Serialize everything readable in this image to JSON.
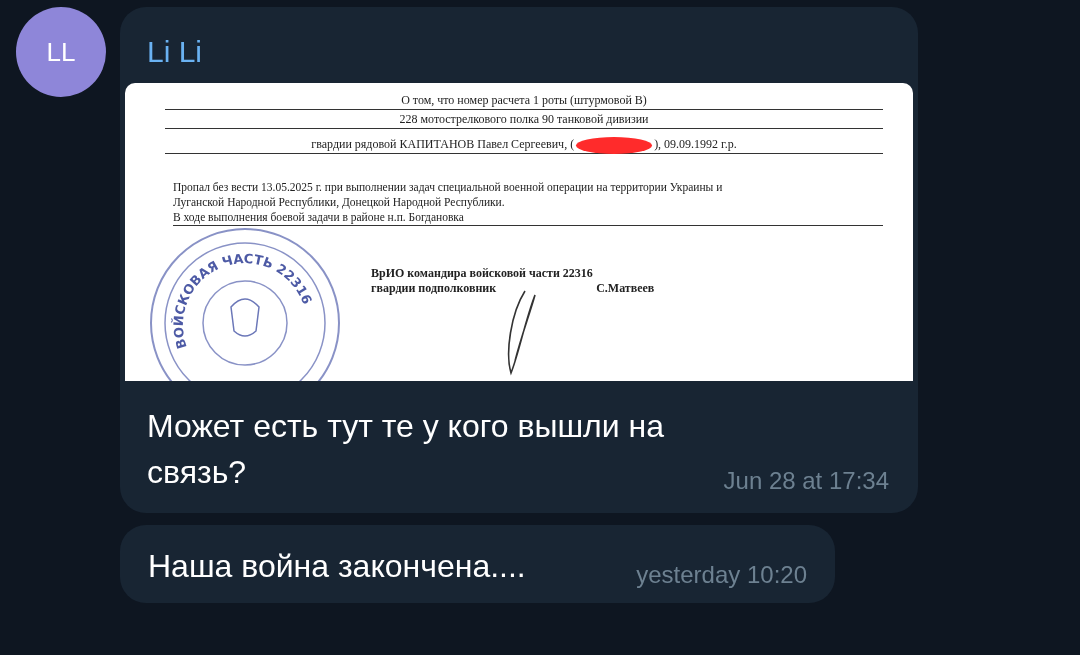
{
  "contact": {
    "initials": "LL"
  },
  "messages": [
    {
      "kind": "document",
      "sender": "Li Li",
      "document": {
        "heading_lines": [
          "О том, что номер расчета 1 роты (штурмовой В)",
          "228 мотострелкового полка 90 танковой дивизии"
        ],
        "name_before": "гвардии рядовой КАПИТАНОВ Павел Сергеевич, (",
        "name_after": "), 09.09.1992 г.р.",
        "body_lines": [
          "Пропал без вести 13.05.2025 г. при выполнении задач специальной военной операции на территории Украины и",
          "Луганской Народной Республики, Донецкой Народной Республики."
        ],
        "task_line": "В ходе выполнения боевой задачи в районе н.п. Богдановка",
        "stamp_text": "ВОЙСКОВАЯ ЧАСТЬ 22316",
        "signature_title": "ВрИО командира войсковой части 22316",
        "signature_rank": "гвардии подполковник",
        "signature_name": "С.Матвеев"
      },
      "text": "Может есть тут те у кого вышли на связь?",
      "time": "Jun 28 at 17:34"
    },
    {
      "kind": "text",
      "text": "Наша война закончена....",
      "time": "yesterday 10:20"
    }
  ]
}
